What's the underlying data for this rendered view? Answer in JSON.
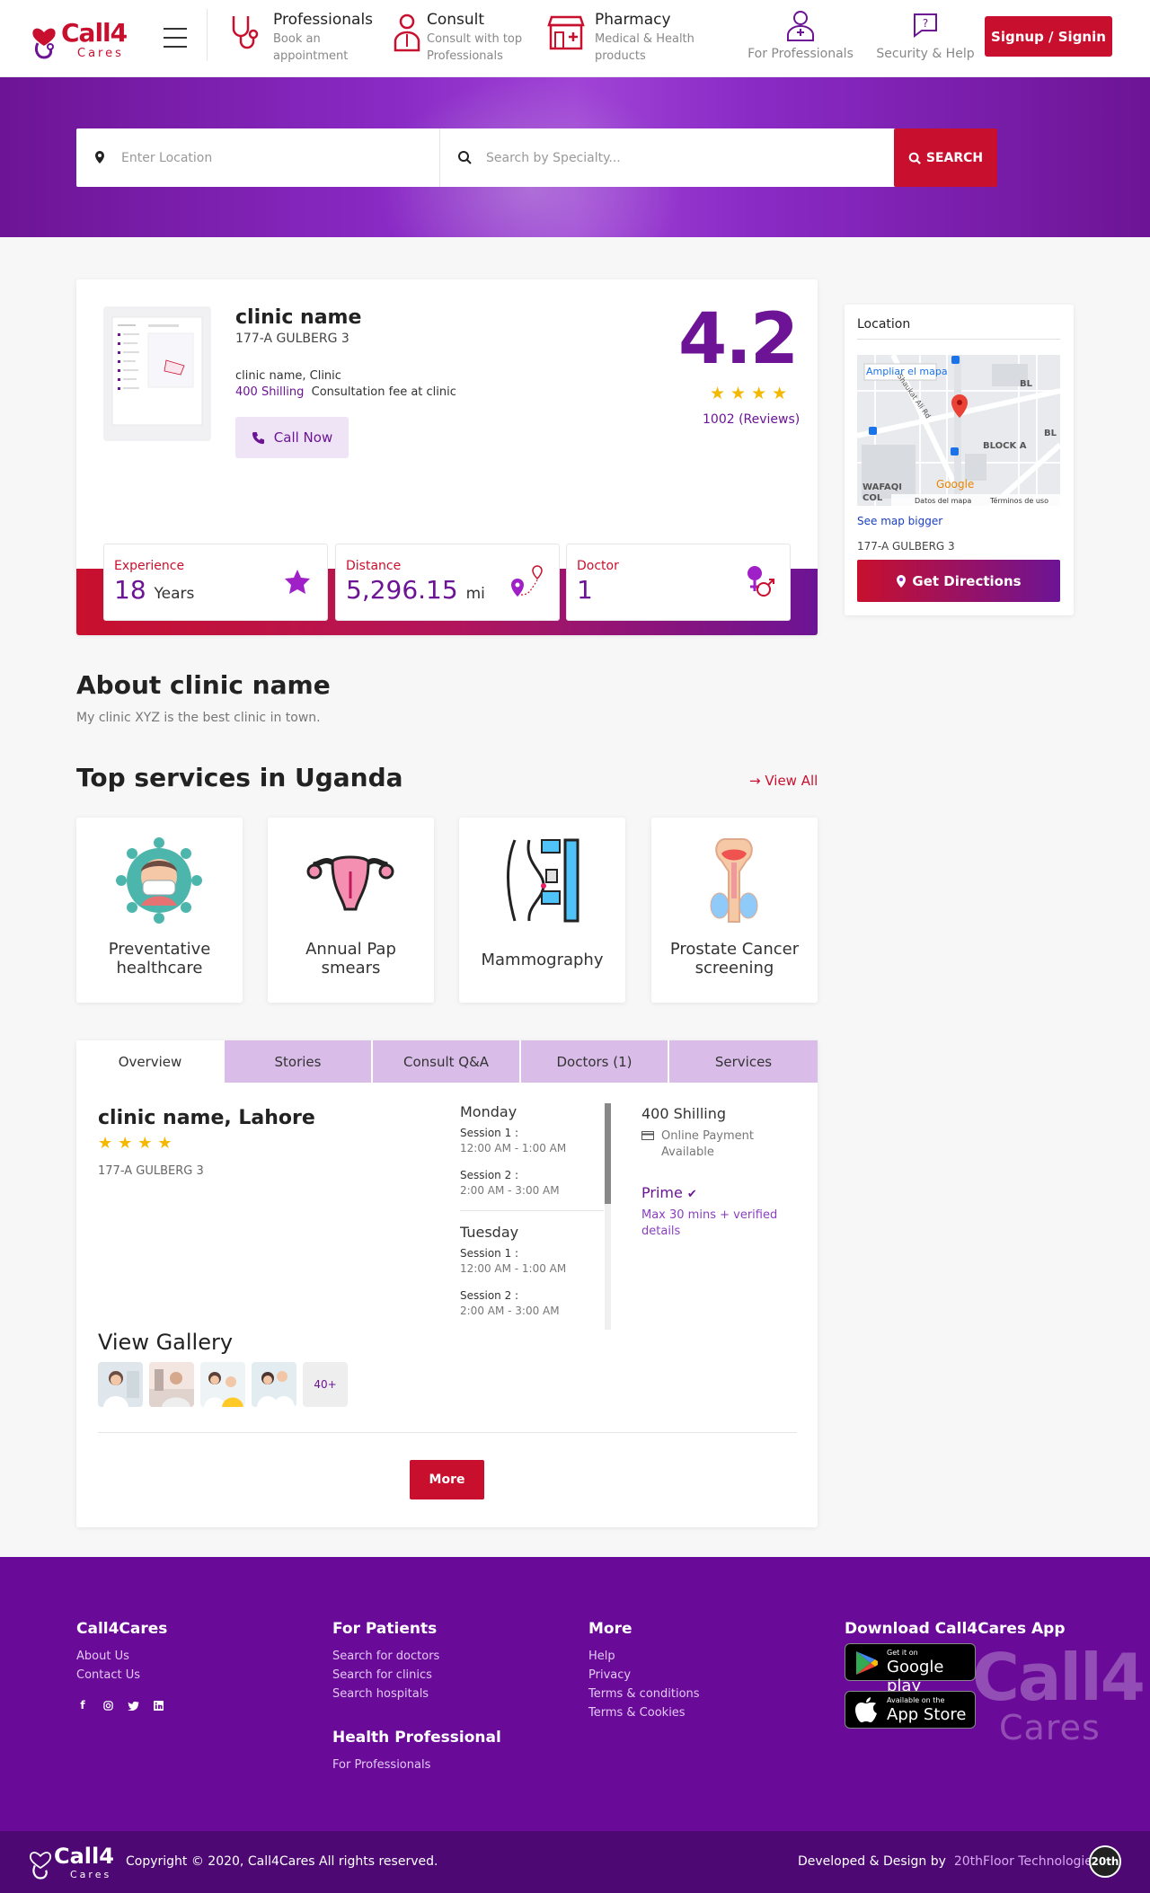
{
  "header": {
    "logo_main": "Call4",
    "logo_sub": "Cares",
    "nav": [
      {
        "title": "Professionals",
        "sub1": "Book an",
        "sub2": "appointment",
        "icon": "stethoscope-icon"
      },
      {
        "title": "Consult",
        "sub1": "Consult with top",
        "sub2": "Professionals",
        "icon": "doctor-icon"
      },
      {
        "title": "Pharmacy",
        "sub1": "Medical & Health",
        "sub2": "products",
        "icon": "pharmacy-store-icon"
      }
    ],
    "for_professionals": "For Professionals",
    "security_help": "Security & Help",
    "signin": "Signup / Signin"
  },
  "search": {
    "location_placeholder": "Enter Location",
    "specialty_placeholder": "Search by Specialty...",
    "button": "SEARCH"
  },
  "clinic": {
    "name": "clinic name",
    "address": "177-A GULBERG 3",
    "type": "clinic name, Clinic",
    "fee_amount": "400 Shilling",
    "fee_label": "Consultation fee at clinic",
    "call": "Call Now",
    "rating": "4.2",
    "stars": "★★★★",
    "reviews": "1002 (Reviews)",
    "stats": {
      "experience_label": "Experience",
      "experience_value": "18",
      "experience_unit": "Years",
      "distance_label": "Distance",
      "distance_value": "5,296.15",
      "distance_unit": "mi",
      "doctor_label": "Doctor",
      "doctor_value": "1"
    }
  },
  "location": {
    "title": "Location",
    "map_enlarge": "Ampliar el mapa",
    "map_labels": [
      "BL",
      "BLOCK A",
      "BL",
      "WAFAQI",
      "COL",
      "Shaukat Ali Rd",
      "Google",
      "Datos del mapa",
      "Términos de uso"
    ],
    "see_bigger": "See map bigger",
    "address": "177-A GULBERG 3",
    "directions": "Get Directions"
  },
  "about": {
    "title": "About clinic name",
    "text": "My clinic XYZ is the best clinic in town."
  },
  "services": {
    "title": "Top services in Uganda",
    "view_all": "View All",
    "items": [
      {
        "label1": "Preventative",
        "label2": "healthcare",
        "icon": "virus-mask-icon"
      },
      {
        "label1": "Annual Pap",
        "label2": "smears",
        "icon": "uterus-icon"
      },
      {
        "label1": "Mammography",
        "label2": "",
        "icon": "mammography-icon"
      },
      {
        "label1": "Prostate Cancer",
        "label2": "screening",
        "icon": "prostate-icon"
      }
    ]
  },
  "tabs": {
    "items": [
      "Overview",
      "Stories",
      "Consult Q&A",
      "Doctors (1)",
      "Services"
    ],
    "overview": {
      "name": "clinic name, Lahore",
      "stars": "★★★★",
      "address": "177-A GULBERG 3",
      "schedule": [
        {
          "day": "Monday",
          "sessions": [
            {
              "label": "Session 1 :",
              "time": "12:00 AM - 1:00 AM"
            },
            {
              "label": "Session 2 :",
              "time": "2:00 AM - 3:00 AM"
            }
          ]
        },
        {
          "day": "Tuesday",
          "sessions": [
            {
              "label": "Session 1 :",
              "time": "12:00 AM - 1:00 AM"
            },
            {
              "label": "Session 2 :",
              "time": "2:00 AM - 3:00 AM"
            }
          ]
        }
      ],
      "fee": "400 Shilling",
      "payment1": "Online Payment",
      "payment2": "Available",
      "prime": "Prime",
      "prime_desc1": "Max 30 mins + verified",
      "prime_desc2": "details",
      "gallery_title": "View Gallery",
      "gallery_more": "40+",
      "more": "More"
    }
  },
  "footer": {
    "col1_title": "Call4Cares",
    "col1_links": [
      "About Us",
      "Contact Us"
    ],
    "col2_title": "For Patients",
    "col2_links": [
      "Search for doctors",
      "Search for clinics",
      "Search hospitals"
    ],
    "col2b_title": "Health Professional",
    "col2b_links": [
      "For Professionals"
    ],
    "col3_title": "More",
    "col3_links": [
      "Help",
      "Privacy",
      "Terms & conditions",
      "Terms & Cookies"
    ],
    "col4_title": "Download Call4Cares App",
    "gplay_small": "Get it on",
    "gplay_big": "Google play",
    "appstore_small": "Available on the",
    "appstore_big": "App Store",
    "watermark1": "Call4",
    "watermark2": "Cares",
    "social_icons": [
      "facebook-icon",
      "instagram-icon",
      "twitter-icon",
      "linkedin-icon"
    ],
    "copyright": "Copyright © 2020, Call4Cares All rights reserved.",
    "dev_prefix": "Developed & Design by",
    "dev_name": "20thFloor Technologies",
    "dev_badge": "20th"
  },
  "colors": {
    "brand_red": "#c8102e",
    "brand_purple": "#6c1495",
    "star": "#f5b800"
  }
}
